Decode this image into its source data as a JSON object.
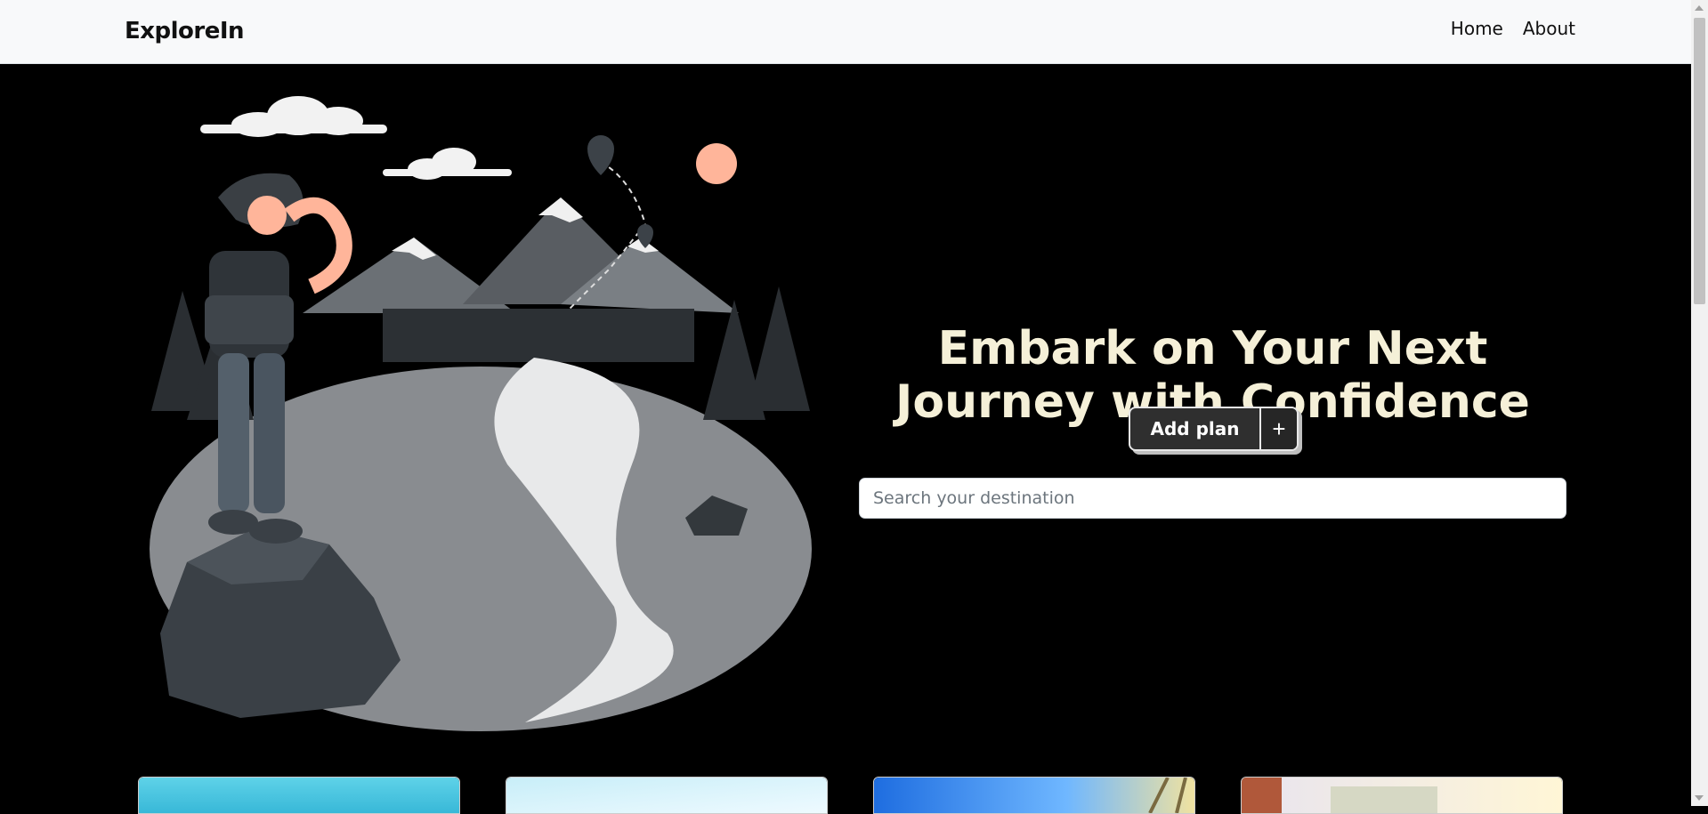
{
  "navbar": {
    "brand": "ExploreIn",
    "links": [
      {
        "label": "Home"
      },
      {
        "label": "About"
      }
    ]
  },
  "hero": {
    "headline": "Embark on Your Next Journey with Confidence",
    "add_plan_label": "Add plan",
    "add_plan_icon": "+",
    "search_placeholder": "Search your destination",
    "illustration": "hiker-on-mountain-illustration"
  },
  "cards": [
    {
      "image": "ocean-image"
    },
    {
      "image": "beach-image"
    },
    {
      "image": "palm-sunset-image"
    },
    {
      "image": "city-building-image"
    }
  ],
  "colors": {
    "background": "#000000",
    "headline": "#f5f0d8",
    "navbar": "#f8f9fa",
    "button": "#2f2f2f"
  }
}
